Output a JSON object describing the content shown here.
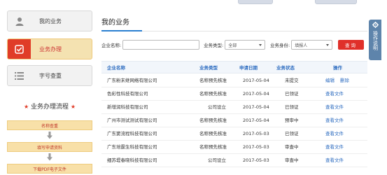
{
  "sidebar": {
    "items": [
      {
        "label": "我的业务",
        "icon": "user-icon"
      },
      {
        "label": "业务办理",
        "icon": "checkbox-icon"
      },
      {
        "label": "字号查重",
        "icon": "list-icon"
      }
    ],
    "flow_title": "业务办理流程",
    "flow_steps": [
      "名称查重",
      "填写申请资料",
      "下载PDF电子文件"
    ]
  },
  "main": {
    "title": "我的业务",
    "filters": {
      "company_label": "企业名称:",
      "type_label": "业务类型:",
      "type_value": "全部",
      "role_label": "业务身份:",
      "role_value": "填报人",
      "search_label": "查询"
    },
    "table": {
      "headers": [
        "企业名称",
        "业务类型",
        "申请日期",
        "业务状态",
        "操作"
      ],
      "rows": [
        {
          "company": "广东粉末继网络有限公司",
          "type": "名称预先核准",
          "date": "2017-05-04",
          "status": "未提交",
          "actions": [
            "编辑",
            "删除"
          ]
        },
        {
          "company": "色彩性科技有限公司",
          "type": "名称预先核准",
          "date": "2017-05-04",
          "status": "已领证",
          "actions": [
            "查看文件"
          ]
        },
        {
          "company": "新增润科技有限公司",
          "type": "公司设立",
          "date": "2017-05-04",
          "status": "已领证",
          "actions": [
            "查看文件"
          ]
        },
        {
          "company": "广州市测试测试有限公司",
          "type": "名称预先核准",
          "date": "2017-05-04",
          "status": "预审中",
          "actions": [
            "查看文件"
          ]
        },
        {
          "company": "广东窦流程科技有限公司",
          "type": "名称预先核准",
          "date": "2017-05-03",
          "status": "已领证",
          "actions": [
            "查看文件"
          ]
        },
        {
          "company": "广东培霆生科技有限公司",
          "type": "名称预先核准",
          "date": "2017-05-03",
          "status": "审查中",
          "actions": [
            "查看文件"
          ]
        },
        {
          "company": "细苏堤春晓科技有限公司",
          "type": "公司设立",
          "date": "2017-05-03",
          "status": "审查中",
          "actions": [
            "查看文件"
          ]
        }
      ]
    }
  },
  "side_tab": {
    "label": "操作说明",
    "icon": "gear-icon"
  },
  "colors": {
    "accent_red": "#e03c28",
    "link_blue": "#2d6cc0",
    "highlight": "#f4e2b1"
  }
}
